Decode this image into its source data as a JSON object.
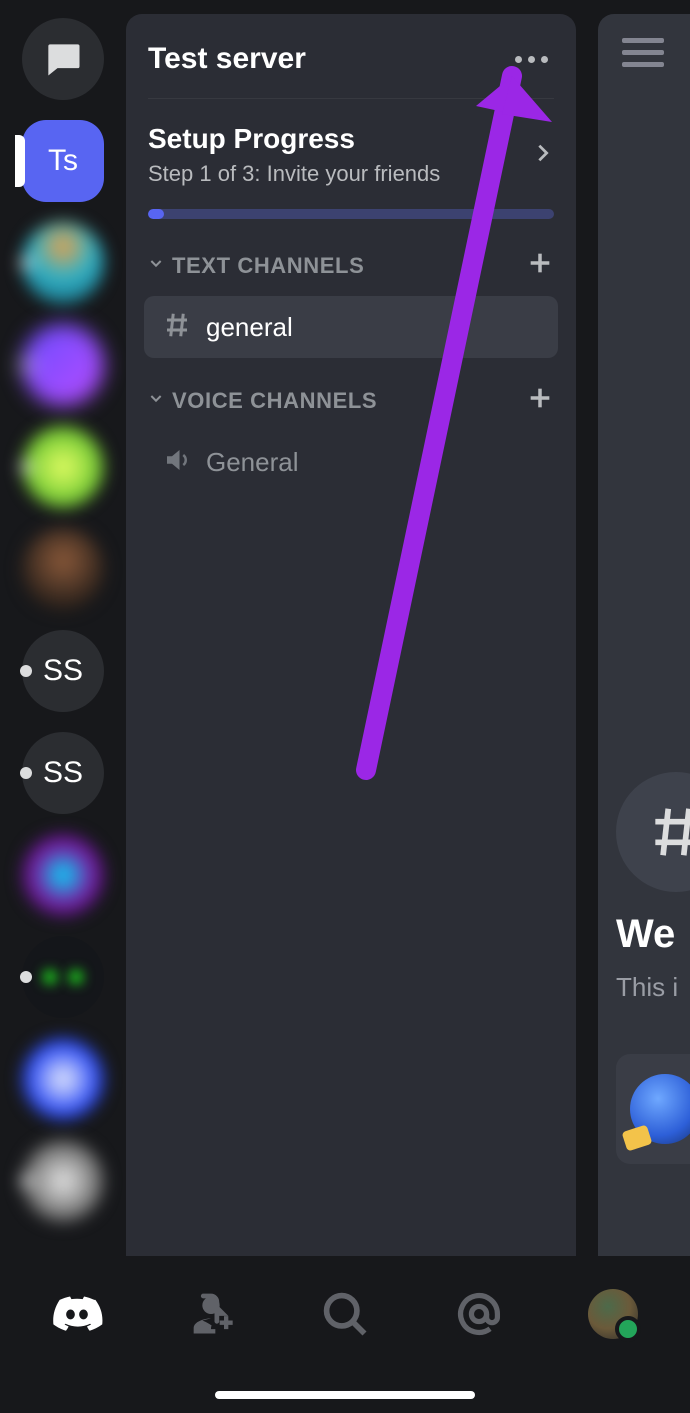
{
  "server": {
    "name": "Test server",
    "icon_label": "Ts"
  },
  "setup": {
    "title": "Setup Progress",
    "step_text": "Step 1 of 3: Invite your friends",
    "progress_percent": 4
  },
  "categories": [
    {
      "name": "TEXT CHANNELS",
      "channels": [
        {
          "name": "general",
          "type": "text",
          "active": true
        }
      ]
    },
    {
      "name": "VOICE CHANNELS",
      "channels": [
        {
          "name": "General",
          "type": "voice",
          "active": false
        }
      ]
    }
  ],
  "rail": {
    "extra_servers": [
      {
        "label": "SS"
      },
      {
        "label": "SS"
      }
    ]
  },
  "peek": {
    "welcome": "We",
    "subtitle": "This i"
  },
  "colors": {
    "accent": "#5865f2",
    "annotation": "#9b27e6"
  }
}
